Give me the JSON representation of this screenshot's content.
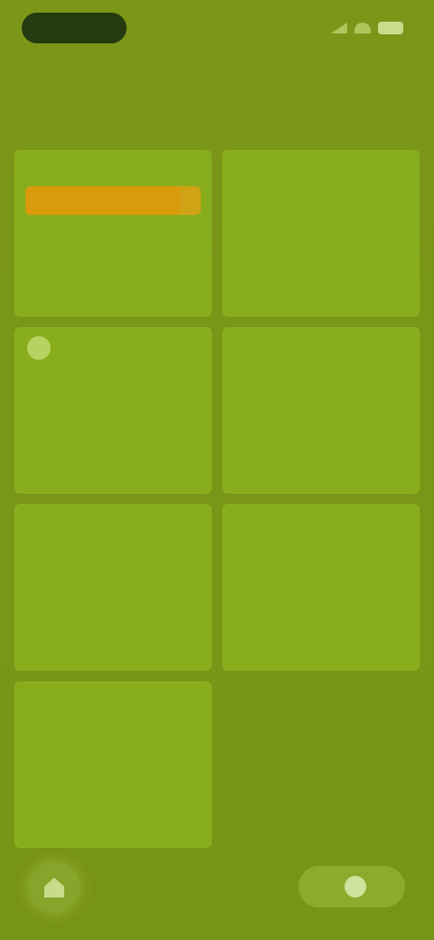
{
  "status": {
    "pill_text": "",
    "icons": [
      "signal-icon",
      "wifi-icon",
      "battery-icon"
    ]
  },
  "header": {
    "title": "",
    "subtitle": ""
  },
  "tiles": [
    {
      "label": "",
      "icon": "",
      "progress": 0.88
    },
    {
      "label": "",
      "icon": ""
    },
    {
      "label": "",
      "icon": "sun-icon"
    },
    {
      "label": "",
      "icon": ""
    },
    {
      "label": "",
      "icon": ""
    },
    {
      "label": "",
      "icon": ""
    },
    {
      "label": "",
      "icon": ""
    }
  ],
  "bottom": {
    "left_icon": "home-icon",
    "right_label": "",
    "right_icon": "plus-icon"
  },
  "colors": {
    "background": "#7a9718",
    "tile": "#88ad1c",
    "accent": "#d99a0c",
    "status_pill": "#263a10"
  }
}
